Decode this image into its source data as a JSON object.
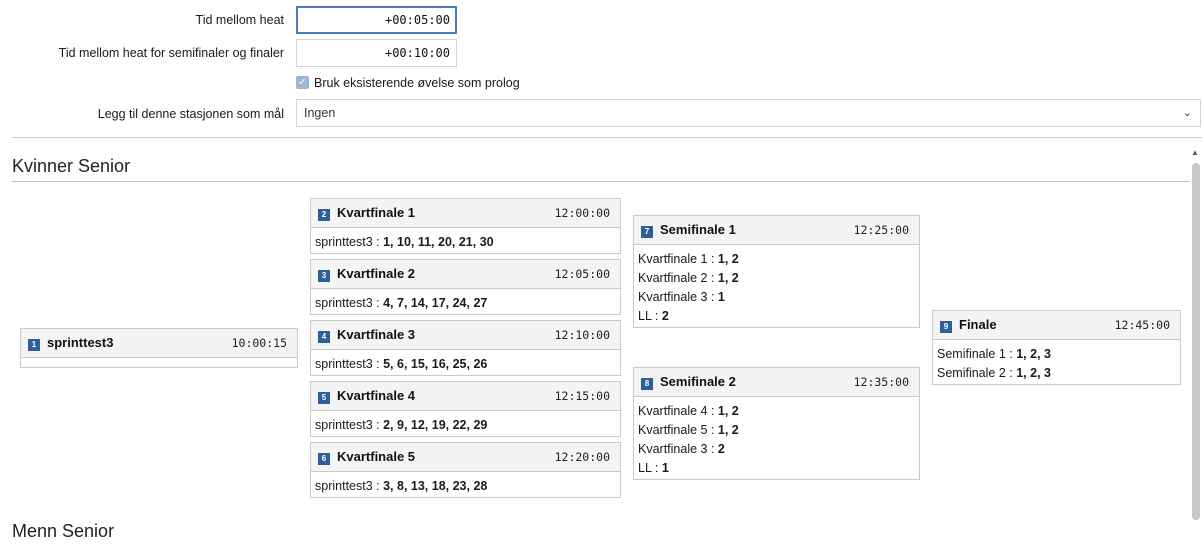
{
  "settings": {
    "time_between_heats_label": "Tid mellom heat",
    "time_between_heats_value": "+00:05:00",
    "time_between_semis_label": "Tid mellom heat for semifinaler og finaler",
    "time_between_semis_value": "+00:10:00",
    "prolog_checkbox_label": "Bruk eksisterende øvelse som prolog",
    "prolog_checked": true,
    "station_label": "Legg til denne stasjonen som mål",
    "station_value": "Ingen"
  },
  "sections": [
    {
      "title": "Kvinner Senior"
    },
    {
      "title": "Menn Senior"
    }
  ],
  "heats": {
    "h1": {
      "num": "1",
      "title": "sprinttest3",
      "time": "10:00:15"
    },
    "h2": {
      "num": "2",
      "title": "Kvartfinale 1",
      "time": "12:00:00",
      "rows": [
        {
          "k": "sprinttest3",
          "v": "1, 10, 11, 20, 21, 30"
        }
      ]
    },
    "h3": {
      "num": "3",
      "title": "Kvartfinale 2",
      "time": "12:05:00",
      "rows": [
        {
          "k": "sprinttest3",
          "v": "4, 7, 14, 17, 24, 27"
        }
      ]
    },
    "h4": {
      "num": "4",
      "title": "Kvartfinale 3",
      "time": "12:10:00",
      "rows": [
        {
          "k": "sprinttest3",
          "v": "5, 6, 15, 16, 25, 26"
        }
      ]
    },
    "h5": {
      "num": "5",
      "title": "Kvartfinale 4",
      "time": "12:15:00",
      "rows": [
        {
          "k": "sprinttest3",
          "v": "2, 9, 12, 19, 22, 29"
        }
      ]
    },
    "h6": {
      "num": "6",
      "title": "Kvartfinale 5",
      "time": "12:20:00",
      "rows": [
        {
          "k": "sprinttest3",
          "v": "3, 8, 13, 18, 23, 28"
        }
      ]
    },
    "h7": {
      "num": "7",
      "title": "Semifinale 1",
      "time": "12:25:00",
      "rows": [
        {
          "k": "Kvartfinale 1",
          "v": "1, 2"
        },
        {
          "k": "Kvartfinale 2",
          "v": "1, 2"
        },
        {
          "k": "Kvartfinale 3",
          "v": "1"
        },
        {
          "k": "LL",
          "v": "2"
        }
      ]
    },
    "h8": {
      "num": "8",
      "title": "Semifinale 2",
      "time": "12:35:00",
      "rows": [
        {
          "k": "Kvartfinale 4",
          "v": "1, 2"
        },
        {
          "k": "Kvartfinale 5",
          "v": "1, 2"
        },
        {
          "k": "Kvartfinale 3",
          "v": "2"
        },
        {
          "k": "LL",
          "v": "1"
        }
      ]
    },
    "h9": {
      "num": "9",
      "title": "Finale",
      "time": "12:45:00",
      "rows": [
        {
          "k": "Semifinale 1",
          "v": "1, 2, 3"
        },
        {
          "k": "Semifinale 2",
          "v": "1, 2, 3"
        }
      ]
    }
  }
}
